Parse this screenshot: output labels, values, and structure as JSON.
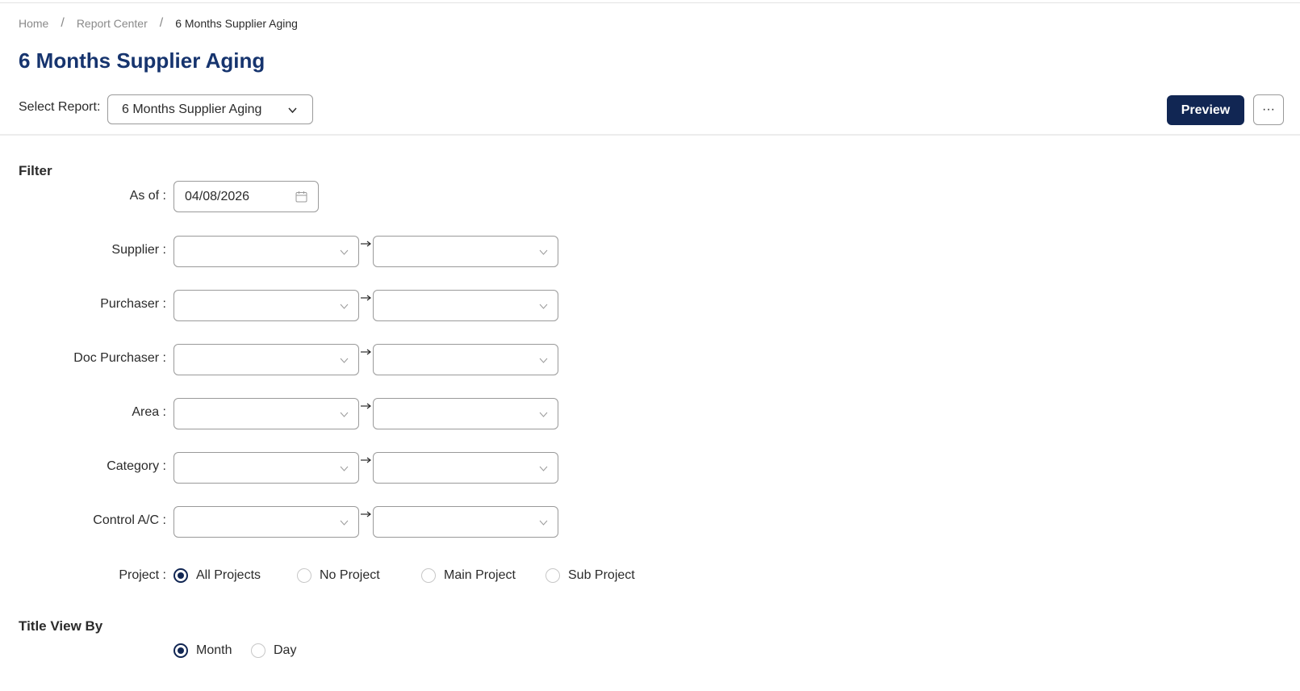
{
  "breadcrumb": {
    "home": "Home",
    "report_center": "Report Center",
    "current": "6 Months Supplier Aging",
    "separator": "/"
  },
  "page_title": "6 Months Supplier Aging",
  "report_selector": {
    "label": "Select Report:",
    "value": "6 Months Supplier Aging"
  },
  "toolbar": {
    "preview_label": "Preview",
    "more_label": "···"
  },
  "filter": {
    "heading": "Filter",
    "as_of": {
      "label": "As of :",
      "value": "04/08/2026",
      "icon": "calendar-icon"
    },
    "ranges": [
      {
        "label": "Supplier :",
        "from": "",
        "to": ""
      },
      {
        "label": "Purchaser :",
        "from": "",
        "to": ""
      },
      {
        "label": "Doc Purchaser :",
        "from": "",
        "to": ""
      },
      {
        "label": "Area :",
        "from": "",
        "to": ""
      },
      {
        "label": "Category :",
        "from": "",
        "to": ""
      },
      {
        "label": "Control A/C :",
        "from": "",
        "to": ""
      }
    ],
    "project": {
      "label": "Project :",
      "options": [
        "All Projects",
        "No Project",
        "Main Project",
        "Sub Project"
      ],
      "selected": "All Projects"
    }
  },
  "title_view": {
    "heading": "Title View By",
    "options": [
      "Month",
      "Day"
    ],
    "selected": "Month"
  },
  "colors": {
    "primary": "#112653",
    "title": "#16346e",
    "border": "#9a9a9a"
  }
}
